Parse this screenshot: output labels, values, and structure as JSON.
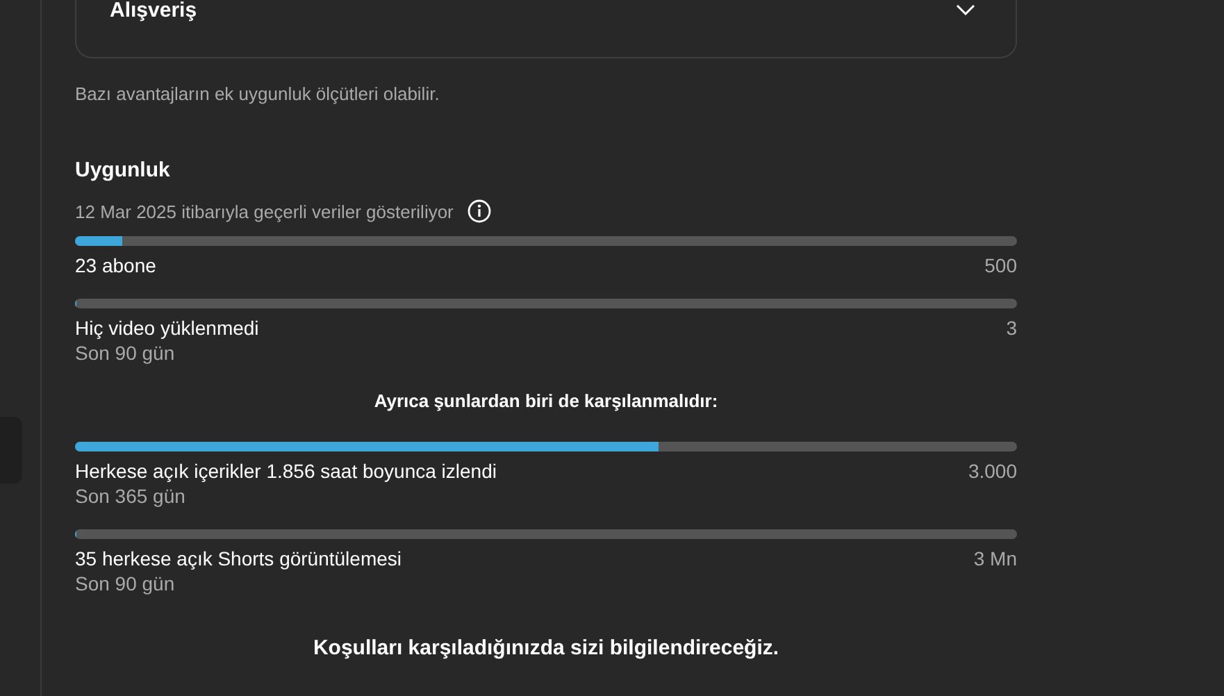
{
  "category_card": {
    "title": "Alışveriş",
    "expanded": false
  },
  "note": "Bazı avantajların ek uygunluk ölçütleri olabilir.",
  "eligibility": {
    "title": "Uygunluk",
    "data_date": "12 Mar 2025 itibarıyla geçerli veriler gösteriliyor",
    "requirements": [
      {
        "label": "23 abone",
        "target": "500",
        "level": 0.05
      },
      {
        "label": "Hiç video yüklenmedi",
        "period": "Son 90 gün",
        "target": "3",
        "level": 0
      }
    ],
    "alternative_heading": "Ayrıca şunlardan biri de karşılanmalıdır:",
    "alternatives": [
      {
        "label": "Herkese açık içerikler 1.856 saat boyunca izlendi",
        "period": "Son 365 gün",
        "target": "3.000",
        "level": 0.62
      },
      {
        "label": "35 herkese açık Shorts görüntülemesi",
        "period": "Son 90 gün",
        "target": "3 Mn",
        "level": 0
      }
    ],
    "footer": "Koşulları karşıladığınızda sizi bilgilendireceğiz."
  }
}
